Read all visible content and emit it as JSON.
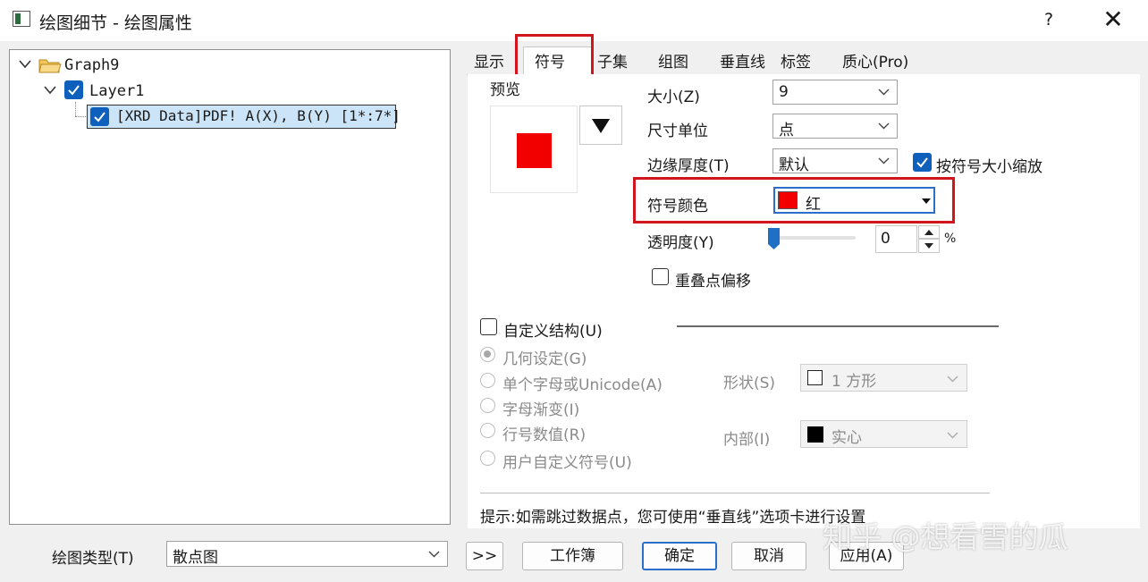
{
  "window": {
    "title": "绘图细节 - 绘图属性",
    "help": "?",
    "close": "✕"
  },
  "tree": {
    "graph": "Graph9",
    "layer": "Layer1",
    "plot": "[XRD Data]PDF! A(X), B(Y) [1*:7*]"
  },
  "tabs": [
    "显示",
    "符号",
    "子集",
    "组图",
    "垂直线",
    "标签",
    "质心(Pro)"
  ],
  "symbol": {
    "preview_label": "预览",
    "preview_color": "#f20000",
    "size_label": "大小(Z)",
    "size_value": "9",
    "unit_label": "尺寸单位",
    "unit_value": "点",
    "edge_label": "边缘厚度(T)",
    "edge_value": "默认",
    "scale_checkbox": "按符号大小缩放",
    "color_label": "符号颜色",
    "color_value": "红",
    "transparency_label": "透明度(Y)",
    "transparency_value": "0",
    "transparency_unit": "%",
    "overlap_checkbox": "重叠点偏移"
  },
  "custom": {
    "checkbox": "自定义结构(U)",
    "options": [
      "几何设定(G)",
      "单个字母或Unicode(A)",
      "字母渐变(I)",
      "行号数值(R)",
      "用户自定义符号(U)"
    ],
    "shape_label": "形状(S)",
    "shape_value": "1 方形",
    "interior_label": "内部(I)",
    "interior_value": "实心"
  },
  "hint": "提示:如需跳过数据点，您可使用“垂直线”选项卡进行设置",
  "footer": {
    "plot_type_label": "绘图类型(T)",
    "plot_type_value": "散点图",
    "expand": ">>",
    "workbook": "工作簿",
    "ok": "确定",
    "cancel": "取消",
    "apply": "应用(A)"
  },
  "watermark": "知乎 @想看雪的瓜"
}
